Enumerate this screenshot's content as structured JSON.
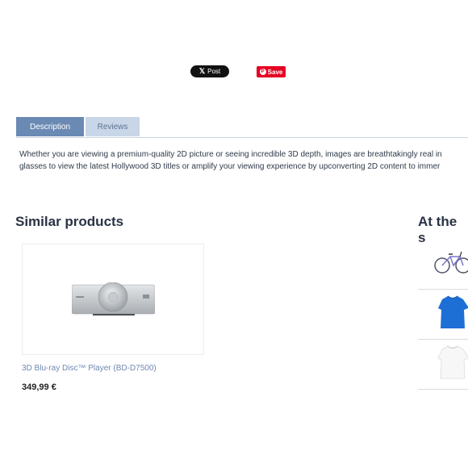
{
  "social": {
    "x_post_label": "Post",
    "x_glyph": "𝕏",
    "pinterest_save_label": "Save",
    "pinterest_glyph": "P"
  },
  "tabs": [
    {
      "label": "Description",
      "active": true
    },
    {
      "label": "Reviews",
      "active": false
    }
  ],
  "description": {
    "line1": "Whether you are viewing a premium-quality 2D picture or seeing incredible 3D depth, images are breathtakingly real in",
    "line2": "glasses to view the latest Hollywood 3D titles or amplify your viewing experience by upconverting 2D content to immer"
  },
  "similar_products": {
    "title": "Similar products",
    "items": [
      {
        "name": "3D Blu-ray Disc™ Player (BD-D7500)",
        "price": "349,99 €",
        "image_icon": "blu-ray-player-image"
      }
    ]
  },
  "sidebar": {
    "title": "At the s",
    "items": [
      {
        "image_icon": "bicycle-image"
      },
      {
        "image_icon": "blue-tshirt-image"
      },
      {
        "image_icon": "white-tshirt-image"
      }
    ]
  },
  "colors": {
    "tab_active_bg": "#6b8ab3",
    "tab_inactive_bg": "#c8d6e8",
    "link": "#6f89b0",
    "pinterest_red": "#e60023"
  }
}
